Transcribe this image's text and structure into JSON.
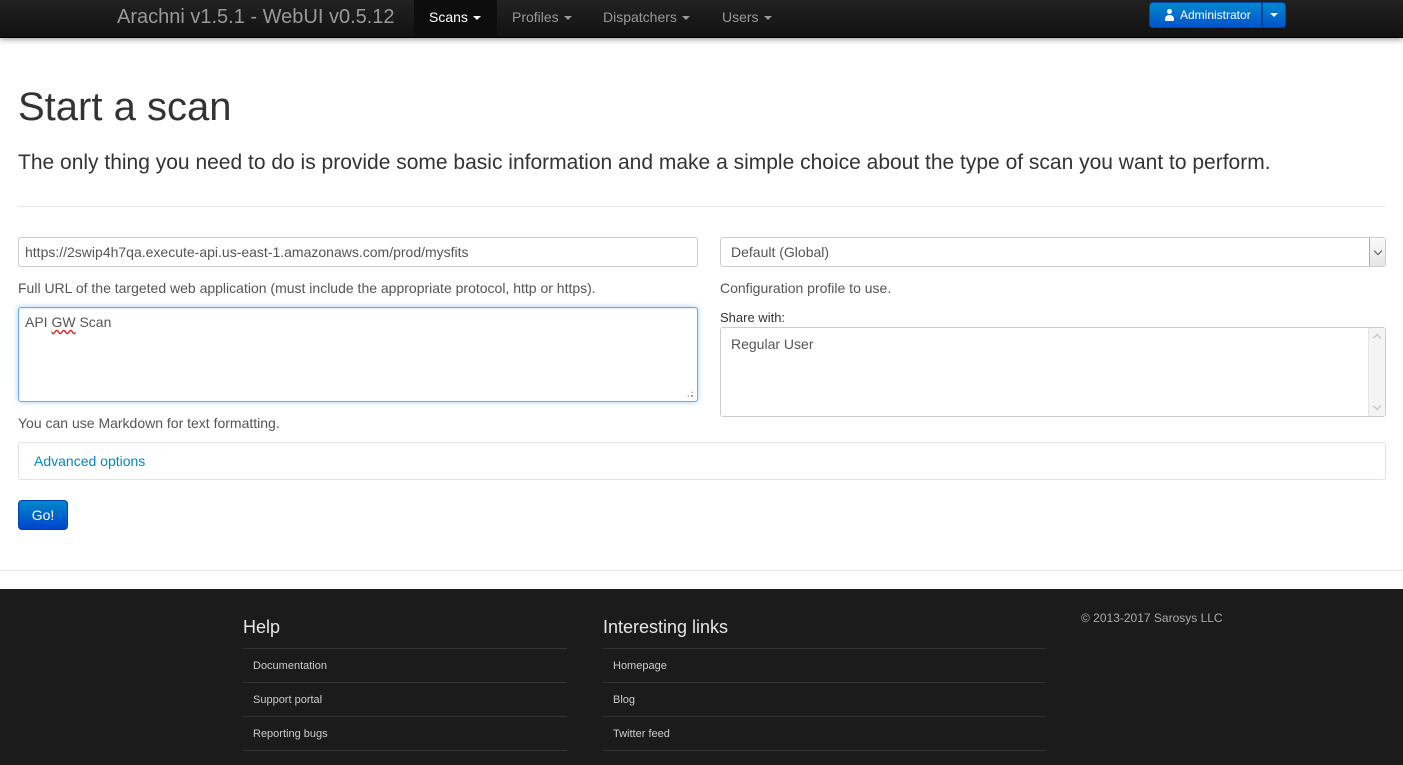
{
  "navbar": {
    "brand": "Arachni v1.5.1 - WebUI v0.5.12",
    "items": [
      {
        "label": "Scans",
        "active": true
      },
      {
        "label": "Profiles",
        "active": false
      },
      {
        "label": "Dispatchers",
        "active": false
      },
      {
        "label": "Users",
        "active": false
      }
    ],
    "user_label": "Administrator"
  },
  "page": {
    "title": "Start a scan",
    "lead": "The only thing you need to do is provide some basic information and make a simple choice about the type of scan you want to perform."
  },
  "form": {
    "url_value": "https://2swip4h7qa.execute-api.us-east-1.amazonaws.com/prod/mysfits",
    "url_help": "Full URL of the targeted web application (must include the appropriate protocol, http or https).",
    "description_part1": "API ",
    "description_misspelled": "GW",
    "description_part2": " Scan",
    "description_help": "You can use Markdown for text formatting.",
    "profile_selected": "Default (Global)",
    "profile_help": "Configuration profile to use.",
    "share_label": "Share with:",
    "share_options": [
      "Regular User"
    ],
    "advanced_label": "Advanced options",
    "submit_label": "Go!"
  },
  "footer": {
    "help": {
      "heading": "Help",
      "links": [
        "Documentation",
        "Support portal",
        "Reporting bugs"
      ]
    },
    "interesting": {
      "heading": "Interesting links",
      "links": [
        "Homepage",
        "Blog",
        "Twitter feed"
      ]
    },
    "copyright": "© 2013-2017 Sarosys LLC"
  },
  "colors": {
    "navbar_bg": "#1b1b1b",
    "primary": "#0088cc",
    "focus_border": "#66afe9",
    "footer_bg": "#1b1b1b"
  }
}
